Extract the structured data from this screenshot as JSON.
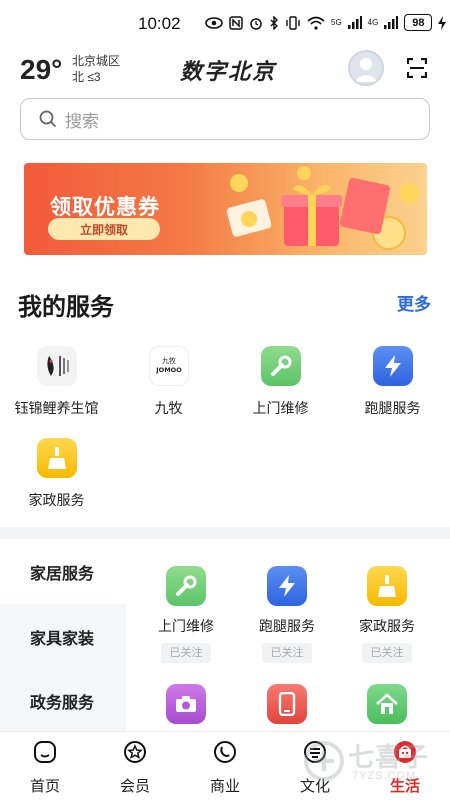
{
  "status": {
    "time": "10:02",
    "battery": "98",
    "signal1": "5G",
    "signal2": "4G"
  },
  "header": {
    "temperature": "29°",
    "location": "北京城区",
    "wind": "北  ≤3",
    "title": "数字北京",
    "avatar_icon": "user-avatar",
    "scan_icon": "scan-icon"
  },
  "search": {
    "placeholder": "搜索"
  },
  "banner": {
    "title": "领取优惠券",
    "button": "立即领取"
  },
  "my_services": {
    "title": "我的服务",
    "more": "更多",
    "items": [
      {
        "label": "钰锦鲤养生馆",
        "icon": "koi-logo"
      },
      {
        "label": "九牧",
        "icon": "jomoo-logo"
      },
      {
        "label": "上门维修",
        "icon": "wrench-icon"
      },
      {
        "label": "跑腿服务",
        "icon": "lightning-icon"
      },
      {
        "label": "家政服务",
        "icon": "broom-icon"
      }
    ]
  },
  "categories": {
    "items": [
      {
        "label": "家居服务"
      },
      {
        "label": "家具家装"
      },
      {
        "label": "政务服务"
      }
    ],
    "services": [
      {
        "label": "上门维修",
        "tag": "已关注",
        "icon": "wrench-icon"
      },
      {
        "label": "跑腿服务",
        "tag": "已关注",
        "icon": "lightning-icon"
      },
      {
        "label": "家政服务",
        "tag": "已关注",
        "icon": "broom-icon"
      },
      {
        "label": "",
        "icon": "camera-icon"
      },
      {
        "label": "",
        "icon": "phone-icon"
      },
      {
        "label": "",
        "icon": "house-icon"
      }
    ]
  },
  "tabbar": {
    "tabs": [
      {
        "label": "首页"
      },
      {
        "label": "会员"
      },
      {
        "label": "商业"
      },
      {
        "label": "文化"
      },
      {
        "label": "生活"
      }
    ],
    "active_color": "#e02a2a"
  },
  "watermark": {
    "text": "七喜子",
    "url": "7YZS.COM"
  },
  "colors": {
    "accent_blue": "#2b6be0",
    "active_red": "#e02a2a"
  }
}
